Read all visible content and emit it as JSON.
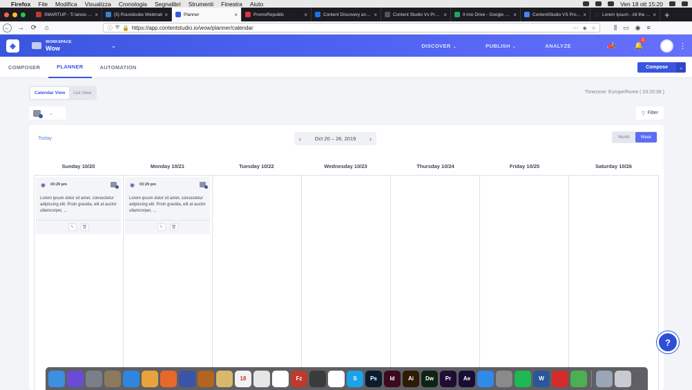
{
  "menubar": {
    "items": [
      "Firefox",
      "File",
      "Modifica",
      "Visualizza",
      "Cronologia",
      "Segnalibri",
      "Strumenti",
      "Finestra",
      "Aiuto"
    ],
    "clock": "Ven 18 ott  15:20"
  },
  "tabs": [
    {
      "title": "SMARTUP - Ti lancio una",
      "color": "#c0392b"
    },
    {
      "title": "(5) Roundcube Webmail",
      "color": "#3b82c4"
    },
    {
      "title": "Planner",
      "color": "#3a56df",
      "active": true
    },
    {
      "title": "PromoRepublic",
      "color": "#d9363e"
    },
    {
      "title": "Content Discovery and C",
      "color": "#1a73e8"
    },
    {
      "title": "Content Studio Vs Promorep",
      "color": "#555555"
    },
    {
      "title": "Il mio Drive - Google Drive",
      "color": "#1fa463"
    },
    {
      "title": "ContentStudio VS Promo",
      "color": "#4285f4"
    },
    {
      "title": "Lorem Ipsum - All the fac",
      "color": "#222222"
    }
  ],
  "url": "https://app.contentstudio.io/wow/planner/calendar",
  "header": {
    "workspace_label": "WORKSPACE",
    "workspace_name": "Wow",
    "nav": [
      "DISCOVER",
      "PUBLISH",
      "ANALYZE"
    ],
    "notification_count": "1"
  },
  "subnav": {
    "tabs": [
      "COMPOSER",
      "PLANNER",
      "AUTOMATION"
    ],
    "compose_label": "Compose"
  },
  "view": {
    "calendar_view": "Calendar View",
    "list_view": "List View",
    "timezone": "Timezone: Europe/Rome ( 03:20:38 )",
    "filter": "Filter"
  },
  "calendar": {
    "today": "Today",
    "range": "Oct 20 – 26, 2019",
    "month": "Month",
    "week": "Week",
    "days": [
      "Sunday 10/20",
      "Monday 10/21",
      "Tuesday 10/22",
      "Wednesday 10/23",
      "Thursday 10/24",
      "Friday 10/25",
      "Saturday 10/26"
    ],
    "posts": [
      {
        "time": "03:29 pm",
        "text": "Lorem ipsum dolor sit amet, consectetur adipiscing elit. Proin gravida, elit at auctor ullamcorper, ..."
      },
      {
        "time": "03:29 pm",
        "text": "Lorem ipsum dolor sit amet, consectetur adipiscing elit. Proin gravida, elit at auctor ullamcorper, ..."
      }
    ]
  },
  "help_label": "?",
  "dock": [
    {
      "name": "finder",
      "color": "#3d8fe0"
    },
    {
      "name": "siri",
      "color": "#6b4bd6"
    },
    {
      "name": "launchpad",
      "color": "#7b7f8a"
    },
    {
      "name": "mail-app",
      "color": "#8c7a5c"
    },
    {
      "name": "safari",
      "color": "#2e86de"
    },
    {
      "name": "chrome",
      "color": "#e8a33d"
    },
    {
      "name": "firefox",
      "color": "#e8682a"
    },
    {
      "name": "app-blue",
      "color": "#3a54a8"
    },
    {
      "name": "app-squirrel",
      "color": "#b4641e"
    },
    {
      "name": "notes",
      "color": "#d9b86a"
    },
    {
      "name": "calendar",
      "color": "#f2f2f2",
      "label": "18"
    },
    {
      "name": "textedit",
      "color": "#e6e6e6"
    },
    {
      "name": "reminders",
      "color": "#ffffff"
    },
    {
      "name": "filezilla",
      "color": "#c0392b",
      "label": "Fz"
    },
    {
      "name": "sublime",
      "color": "#3b3b3b"
    },
    {
      "name": "slack",
      "color": "#ffffff"
    },
    {
      "name": "skype",
      "color": "#1aa3e8",
      "label": "S"
    },
    {
      "name": "photoshop",
      "color": "#0a1c2e",
      "label": "Ps"
    },
    {
      "name": "indesign",
      "color": "#3b0a1e",
      "label": "Id"
    },
    {
      "name": "illustrator",
      "color": "#2e1a05",
      "label": "Ai"
    },
    {
      "name": "dreamweaver",
      "color": "#0d2414",
      "label": "Dw"
    },
    {
      "name": "premiere",
      "color": "#1f0d33",
      "label": "Pr"
    },
    {
      "name": "aftereffects",
      "color": "#1a0d33",
      "label": "Ae"
    },
    {
      "name": "appstore",
      "color": "#2f8ae8"
    },
    {
      "name": "preferences",
      "color": "#8a8a8a"
    },
    {
      "name": "spotify",
      "color": "#1db954"
    },
    {
      "name": "word",
      "color": "#2b579a",
      "label": "W"
    },
    {
      "name": "acrobat",
      "color": "#d62b2b"
    },
    {
      "name": "app-green",
      "color": "#4caf50"
    },
    {
      "name": "folder",
      "color": "#9aa5b5"
    },
    {
      "name": "trash",
      "color": "#c8ccd2"
    }
  ],
  "colors": {
    "brand": "#3a56df",
    "facebook": "#3b5998"
  }
}
